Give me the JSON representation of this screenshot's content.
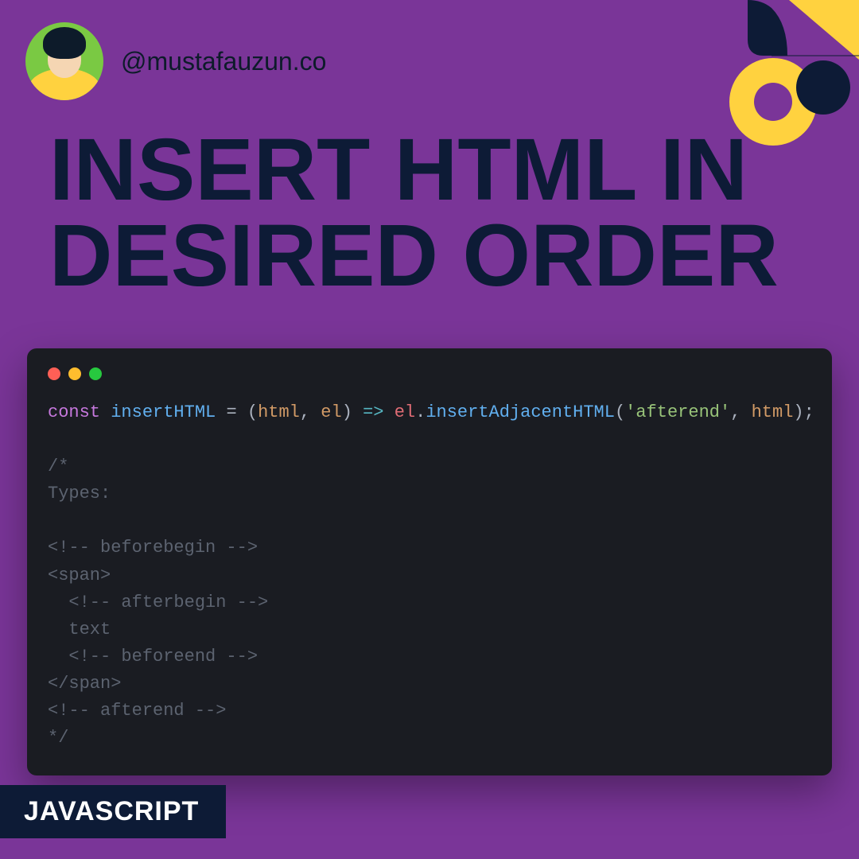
{
  "header": {
    "handle": "@mustafauzun.co"
  },
  "title_line1": "INSERT HTML IN",
  "title_line2": "DESIRED ORDER",
  "code": {
    "tokens": {
      "const": "const",
      "funcName": "insertHTML",
      "eq": " = ",
      "lp": "(",
      "p1": "html",
      "comma": ", ",
      "p2": "el",
      "rp": ")",
      "arrow": " => ",
      "obj": "el",
      "dot": ".",
      "method": "insertAdjacentHTML",
      "lp2": "(",
      "str": "'afterend'",
      "comma2": ", ",
      "arg2": "html",
      "rp2": ")",
      "semi": ";"
    },
    "comment_lines": [
      "/*",
      "Types:",
      "",
      "<!-- beforebegin -->",
      "<span>",
      "  <!-- afterbegin -->",
      "  text",
      "  <!-- beforeend -->",
      "</span>",
      "<!-- afterend -->",
      "*/"
    ]
  },
  "badge": "JAVASCRIPT",
  "colors": {
    "background": "#7a3598",
    "dark": "#0d1b36",
    "yellow": "#ffd23f",
    "codeBg": "#1a1c22"
  }
}
